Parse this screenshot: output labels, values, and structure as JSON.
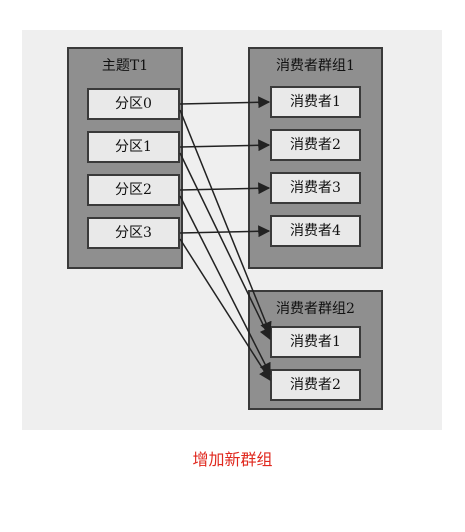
{
  "topic": {
    "title": "主题T1",
    "partitions": [
      "分区0",
      "分区1",
      "分区2",
      "分区3"
    ]
  },
  "group1": {
    "title": "消费者群组1",
    "consumers": [
      "消费者1",
      "消费者2",
      "消费者3",
      "消费者4"
    ]
  },
  "group2": {
    "title": "消费者群组2",
    "consumers": [
      "消费者1",
      "消费者2"
    ]
  },
  "caption": {
    "text": "增加新群组",
    "color": "#e0281e"
  },
  "colors": {
    "group_fill": "#8f8f8f",
    "box_fill": "#e9e9e9",
    "stroke": "#3a3a3a"
  }
}
